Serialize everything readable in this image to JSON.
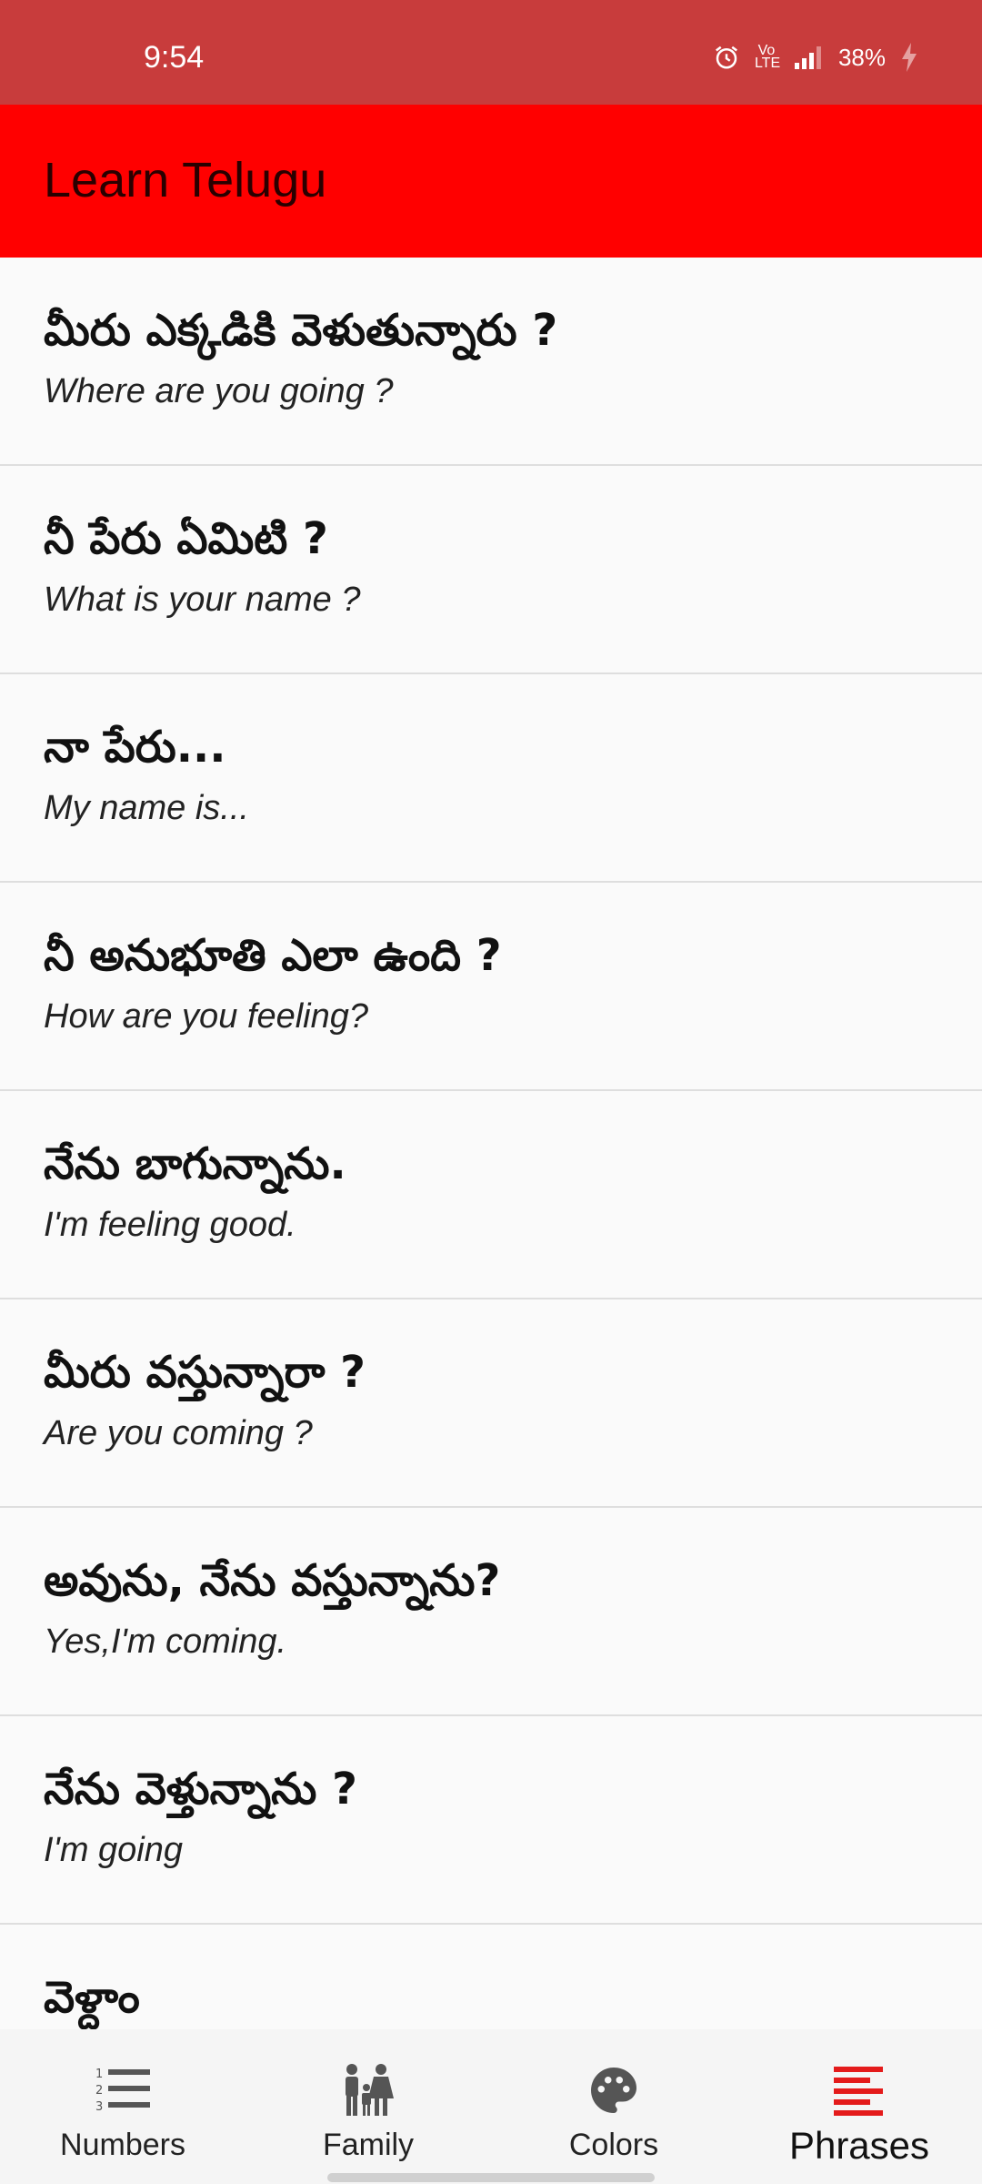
{
  "status_bar": {
    "time": "9:54",
    "network": "Vo LTE",
    "battery": "38%"
  },
  "app_bar": {
    "title": "Learn Telugu"
  },
  "phrases": [
    {
      "telugu": "మీరు ఎక్కడికి వెళుతున్నారు ?",
      "english": "Where are you going ?"
    },
    {
      "telugu": "నీ పేరు ఏమిటి ?",
      "english": "What is your name ?"
    },
    {
      "telugu": "నా పేరు...",
      "english": "My name is..."
    },
    {
      "telugu": "నీ అనుభూతి ఎలా ఉంది ?",
      "english": "How are you feeling?"
    },
    {
      "telugu": "నేను బాగున్నాను.",
      "english": "I'm feeling good."
    },
    {
      "telugu": "మీరు వస్తున్నారా ?",
      "english": "Are you coming ?"
    },
    {
      "telugu": "అవును, నేను వస్తున్నాను?",
      "english": "Yes,I'm coming."
    },
    {
      "telugu": "నేను వెళ్తున్నాను ?",
      "english": "I'm going"
    },
    {
      "telugu": "వెళ్దాం",
      "english": ""
    }
  ],
  "bottom_nav": {
    "items": [
      {
        "label": "Numbers",
        "icon": "numbered-list-icon"
      },
      {
        "label": "Family",
        "icon": "family-icon"
      },
      {
        "label": "Colors",
        "icon": "palette-icon"
      },
      {
        "label": "Phrases",
        "icon": "phrases-icon"
      }
    ],
    "active_index": 3
  },
  "colors": {
    "status_bar": "#c83c3c",
    "app_bar": "#ff0000",
    "active_nav": "#e41b1b",
    "inactive_nav": "#555555"
  }
}
